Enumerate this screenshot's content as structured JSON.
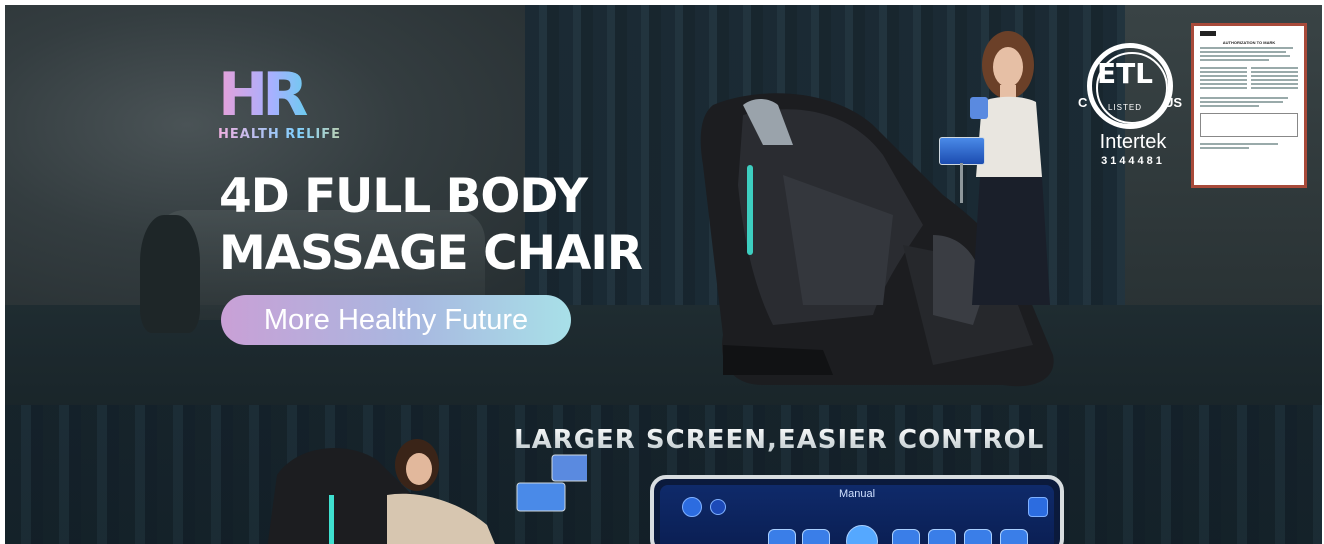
{
  "logo": {
    "mark": "HR",
    "brand_text": "HEALTH RELIFE"
  },
  "headline": {
    "line1": "4D FULL BODY",
    "line2": "MASSAGE CHAIR"
  },
  "tagline": "More Healthy Future",
  "certification": {
    "mark": "ETL",
    "c": "C",
    "us": "US",
    "listed": "LISTED",
    "brand": "Intertek",
    "number": "3144481",
    "document_title": "AUTHORIZATION TO MARK"
  },
  "feature": {
    "heading": "LARGER  SCREEN,EASIER CONTROL",
    "screen_title": "Manual"
  },
  "colors": {
    "accent_glow": "#3fe0d0",
    "pill_start": "#c9a0d6",
    "pill_end": "#a8e0e8",
    "cert_border": "#a84a3a",
    "screen_blue": "#0f2a6a"
  },
  "icons": [
    "home-icon",
    "settings-icon",
    "massage-mode-icon"
  ]
}
